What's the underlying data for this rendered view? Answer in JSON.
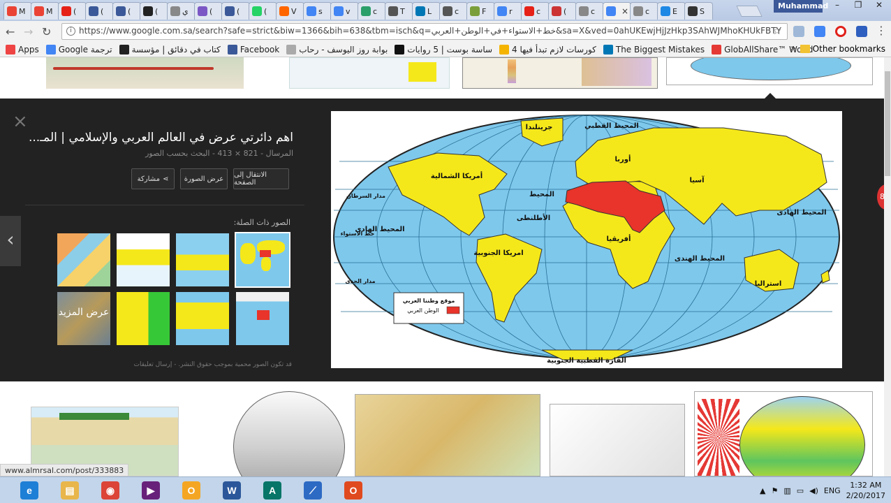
{
  "browser": {
    "profile_name": "Muhammad",
    "url": "https://www.google.com.sa/search?safe=strict&biw=1366&bih=638&tbm=isch&q=خط+الاستواء+في+الوطن+العربي&sa=X&ved=0ahUKEwjHjJzHkp3SAhWJMhoKHUkFBTY",
    "tabs": [
      {
        "label": "M",
        "color": "#ea4335"
      },
      {
        "label": "M",
        "color": "#ea4335"
      },
      {
        "label": "(",
        "color": "#e62117"
      },
      {
        "label": "(",
        "color": "#3b5998"
      },
      {
        "label": "(",
        "color": "#3b5998"
      },
      {
        "label": "(",
        "color": "#222222"
      },
      {
        "label": "ي",
        "color": "#888888"
      },
      {
        "label": "(",
        "color": "#7b57c5"
      },
      {
        "label": "(",
        "color": "#3b5998"
      },
      {
        "label": "(",
        "color": "#25d366"
      },
      {
        "label": "V",
        "color": "#ff6600"
      },
      {
        "label": "s",
        "color": "#4285f4"
      },
      {
        "label": "v",
        "color": "#4285f4"
      },
      {
        "label": "c",
        "color": "#2b9f6a"
      },
      {
        "label": "T",
        "color": "#555555"
      },
      {
        "label": "L",
        "color": "#0077b5"
      },
      {
        "label": "c",
        "color": "#555555"
      },
      {
        "label": "F",
        "color": "#7a9f3a"
      },
      {
        "label": "r",
        "color": "#4285f4"
      },
      {
        "label": "c",
        "color": "#e62117"
      },
      {
        "label": "(",
        "color": "#cc3333"
      },
      {
        "label": "c",
        "color": "#888888"
      },
      {
        "label": "ب",
        "color": "#4285f4"
      },
      {
        "label": "c",
        "color": "#888888"
      },
      {
        "label": "E",
        "color": "#1e88e5"
      },
      {
        "label": "S",
        "color": "#333333"
      }
    ],
    "bookmarks": [
      {
        "label": "Apps",
        "color": "#e44"
      },
      {
        "label": "Google ترجمة",
        "color": "#4285f4"
      },
      {
        "label": "كتاب في دقائق | مؤسسة",
        "color": "#222"
      },
      {
        "label": "Facebook",
        "color": "#3b5998"
      },
      {
        "label": "بوابة روز اليوسف - رحاب",
        "color": "#aaa"
      },
      {
        "label": "ساسة بوست | 5 روايات",
        "color": "#111"
      },
      {
        "label": "4 كورسات لازم تبدأ فيها",
        "color": "#f4b400"
      },
      {
        "label": "The Biggest Mistakes",
        "color": "#0077b5"
      },
      {
        "label": "GlobAllShare™ World",
        "color": "#e53935"
      }
    ],
    "overflow": "»",
    "other_bookmarks": "Other bookmarks"
  },
  "viewer": {
    "title": "اهم دائرتي عرض في العالم العربي والإسلامي | المـ...",
    "meta": "المرسال - 821 × 413 - البحث بحسب الصور",
    "buttons": {
      "visit": "الانتقال إلى الصفحة",
      "view": "عرض الصورة",
      "share": "مشاركة"
    },
    "related_label": "الصور ذات الصلة:",
    "see_more": "عرض المزيد",
    "copyright": "قد تكون الصور محمية بموجب حقوق النشر. - إرسال تعليقات",
    "close_symbol": "×",
    "prev_symbol": "‹"
  },
  "map": {
    "labels": {
      "greenland": "جرينلندا",
      "arctic": "المحيط القطبي",
      "europe": "أوربا",
      "asia": "آسيا",
      "north_america": "أمريكا الشمالية",
      "atlantic1": "المحيط",
      "atlantic2": "الأطلنطى",
      "pacific_east": "المحيط الهادى",
      "pacific_west": "المحيط الهادى",
      "africa": "أفريقيا",
      "south_america": "امريكا الجنوبية",
      "indian": "المحيط الهندى",
      "australia": "استراليا",
      "antarctica": "القارة القطبية الجنوبية",
      "cancer": "مدار السرطان",
      "equator": "خط الاستواء",
      "capricorn": "مدار الجدى",
      "legend_title": "موقع وطننا العربي",
      "legend_item": "الوطن العربي"
    },
    "colors": {
      "ocean": "#7ec8ec",
      "land": "#f5e81a",
      "arab": "#e8342a"
    }
  },
  "status_url": "www.almrsal.com/post/333883",
  "taskbar": {
    "apps": [
      {
        "name": "ie",
        "glyph": "e",
        "color": "#1e7fd6"
      },
      {
        "name": "explorer",
        "glyph": "▤",
        "color": "#e8b64a"
      },
      {
        "name": "chrome",
        "glyph": "◉",
        "color": "#db4437"
      },
      {
        "name": "vs",
        "glyph": "▶",
        "color": "#68217a"
      },
      {
        "name": "outlook",
        "glyph": "O",
        "color": "#f4a623"
      },
      {
        "name": "word",
        "glyph": "W",
        "color": "#2b579a"
      },
      {
        "name": "publisher",
        "glyph": "A",
        "color": "#077568"
      },
      {
        "name": "sketch",
        "glyph": "⟋",
        "color": "#2d6ac4"
      },
      {
        "name": "office",
        "glyph": "O",
        "color": "#e04a1f"
      }
    ],
    "lang": "ENG",
    "time": "1:32 AM",
    "date": "2/20/2017"
  }
}
